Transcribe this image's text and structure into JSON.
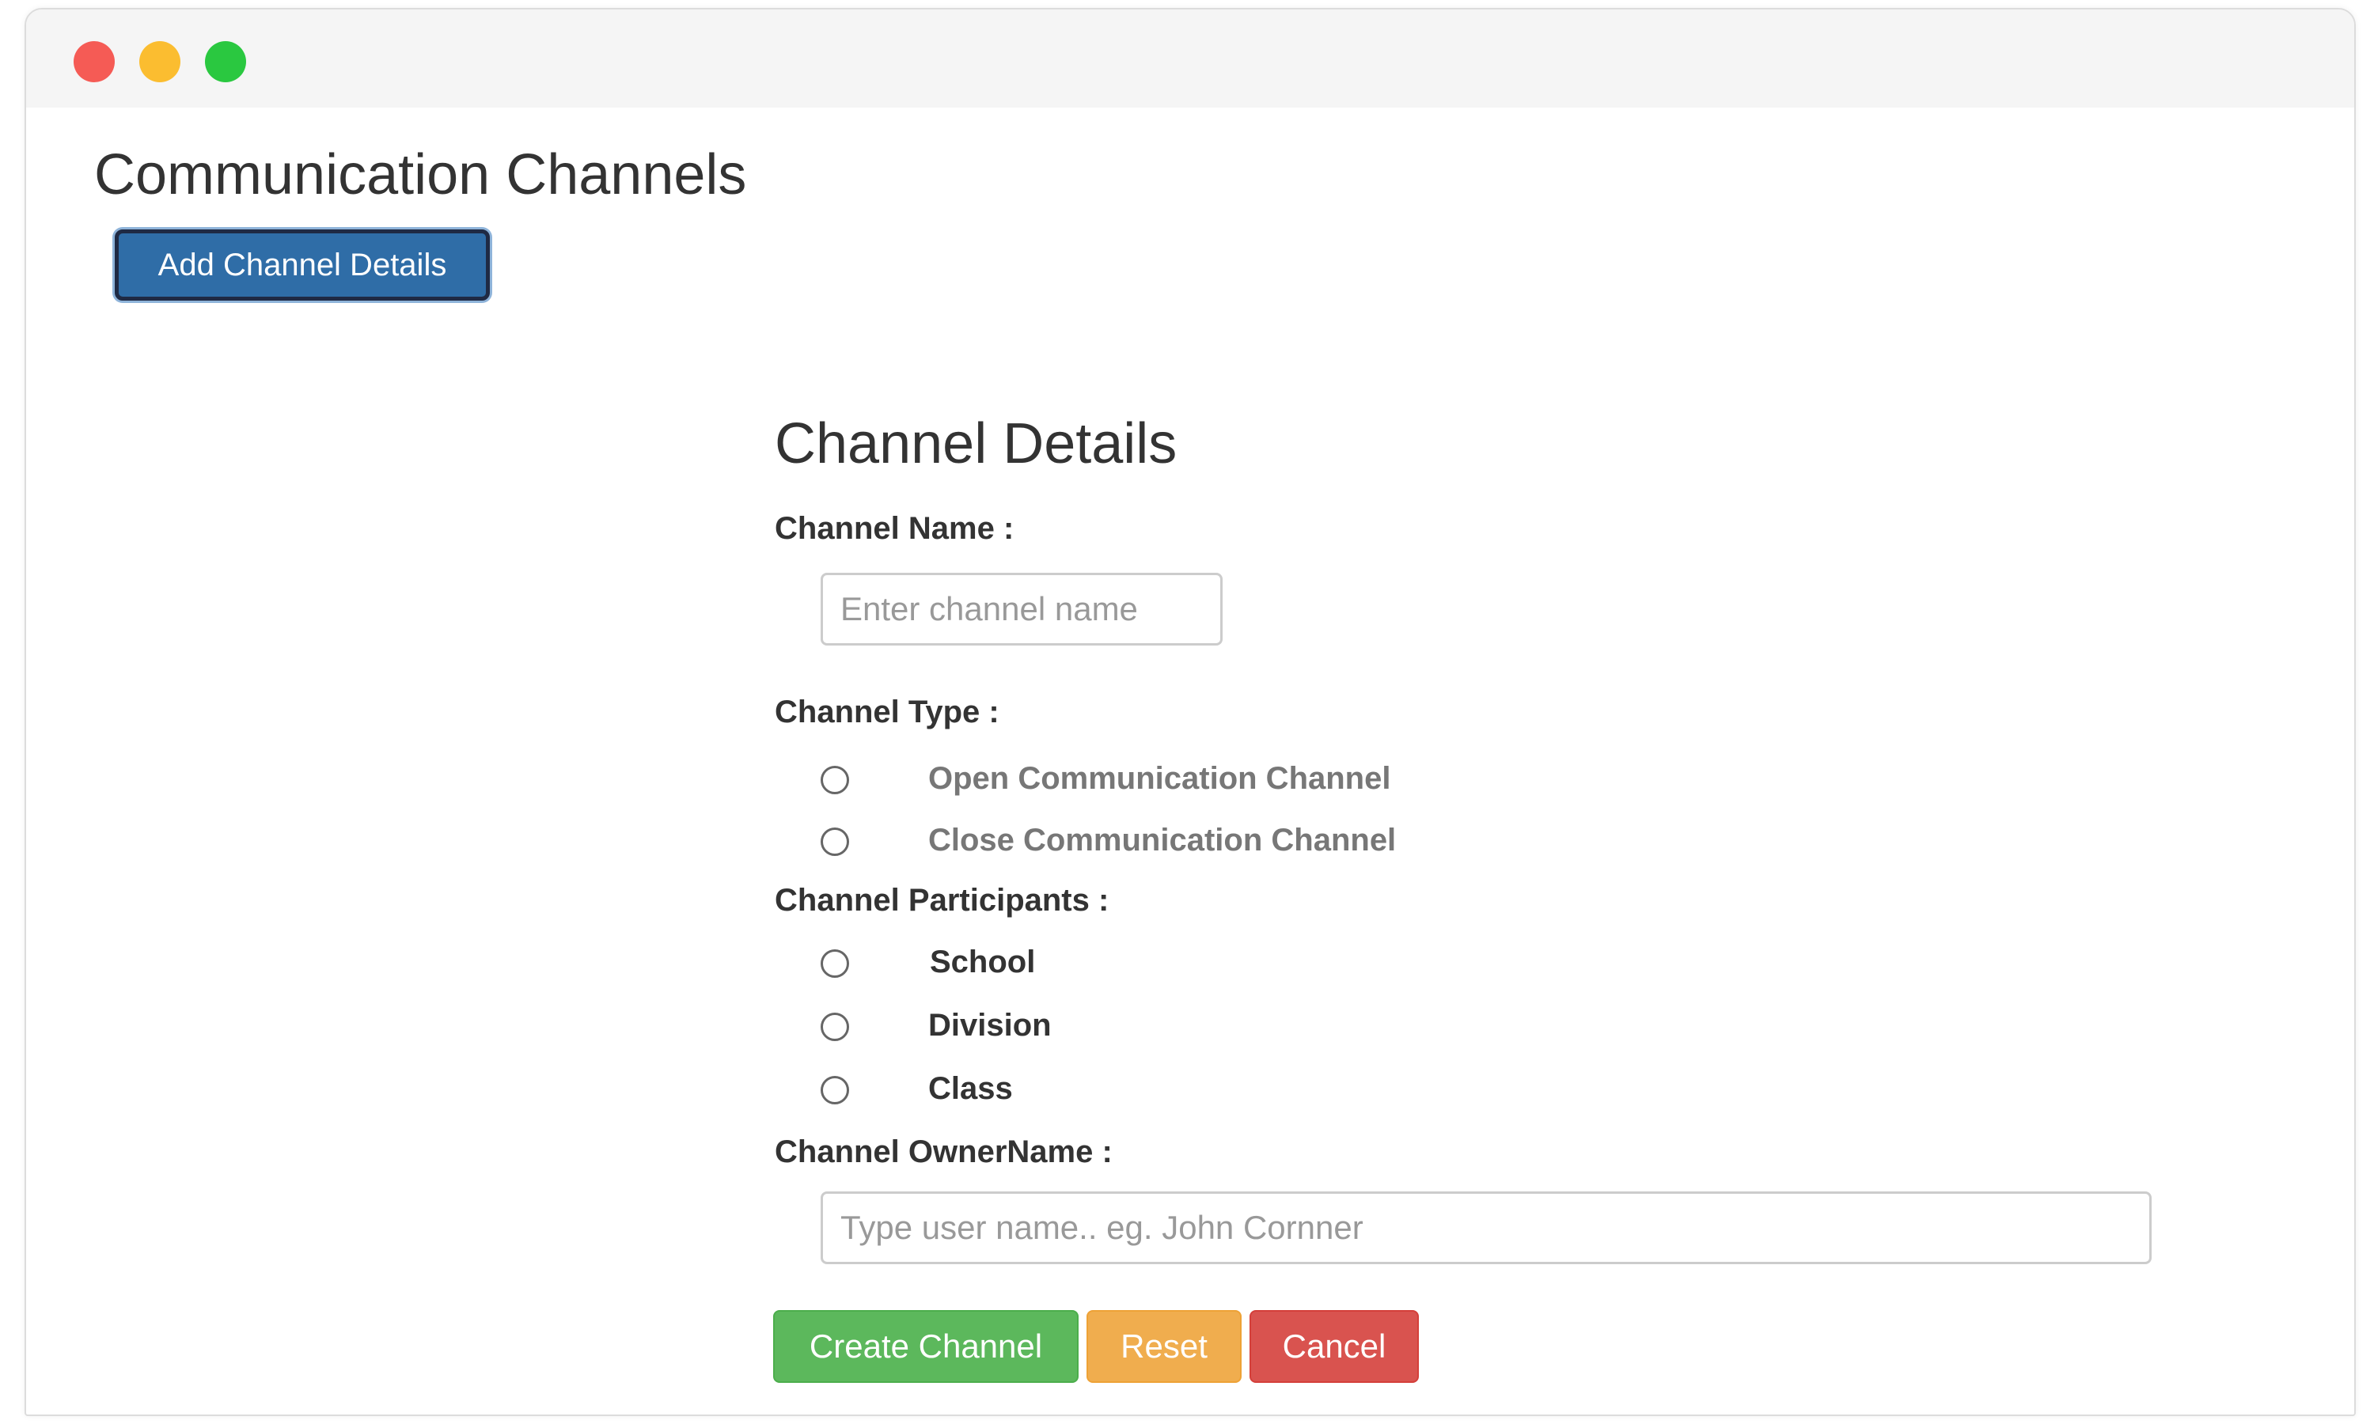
{
  "window": {
    "controls": [
      "close-icon",
      "minimize-icon",
      "maximize-icon"
    ],
    "control_colors": [
      "#f55b55",
      "#fbbd30",
      "#2ac840"
    ]
  },
  "header": {
    "title": "Communication Channels",
    "add_button_label": "Add Channel Details",
    "accent_color": "#2f6da7"
  },
  "form": {
    "title": "Channel Details",
    "channel_name": {
      "label": "Channel Name :",
      "value": "",
      "placeholder": "Enter channel name"
    },
    "channel_type": {
      "label": "Channel Type :",
      "options": [
        {
          "label": "Open Communication Channel",
          "selected": false
        },
        {
          "label": "Close Communication Channel",
          "selected": false
        }
      ]
    },
    "channel_participants": {
      "label": "Channel Participants :",
      "options": [
        {
          "label": "School",
          "selected": false
        },
        {
          "label": "Division",
          "selected": false
        },
        {
          "label": "Class",
          "selected": false
        }
      ]
    },
    "owner_name": {
      "label": "Channel OwnerName :",
      "value": "",
      "placeholder": "Type user name.. eg. John Cornner"
    },
    "actions": {
      "create_label": "Create Channel",
      "reset_label": "Reset",
      "cancel_label": "Cancel",
      "create_color": "#5cb85c",
      "reset_color": "#f0ad4e",
      "cancel_color": "#d9534f"
    }
  }
}
